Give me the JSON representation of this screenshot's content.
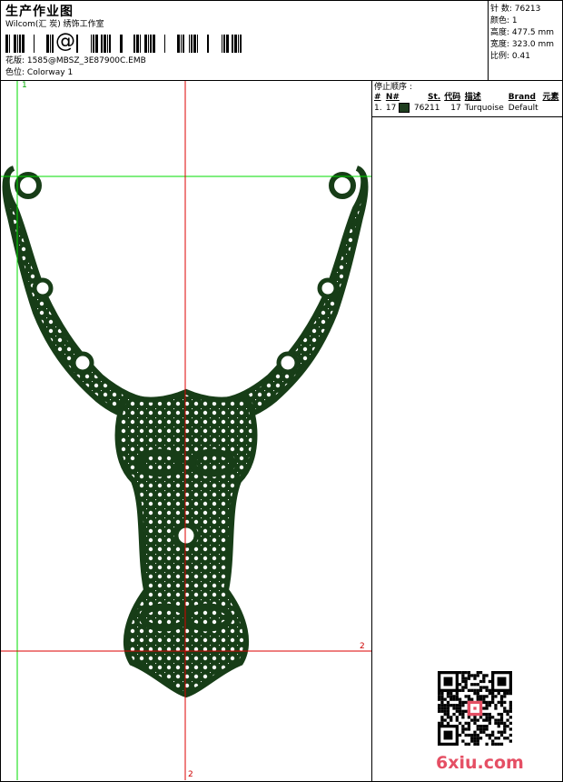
{
  "header": {
    "title": "生产作业图",
    "studio": "Wilcom(汇 炭) 绣饰工作室",
    "design_label": "花版:",
    "design_value": "1585@MBSZ_3E87900C.EMB",
    "colorway_label": "色位:",
    "colorway_value": "Colorway 1",
    "barcode_symbol": "@"
  },
  "stats": {
    "stitches": "针 数: 76213",
    "colors": "颜色: 1",
    "height": "高度: 477.5 mm",
    "width": "宽度: 323.0 mm",
    "scale": "比例: 0.41"
  },
  "sequence": {
    "title": "停止顺序 :",
    "columns": [
      "#",
      "N#",
      "St.",
      "代码",
      "描述",
      "Brand",
      "元素"
    ],
    "rows": [
      {
        "num": "1.",
        "needle": "17",
        "stitches": "76211",
        "code": "17",
        "desc": "Turquoise",
        "brand": "Default",
        "swatch": "#1f3d1f"
      }
    ]
  },
  "guides": {
    "top_label": "1",
    "right_label": "2",
    "bottom_label": "2"
  },
  "colors": {
    "thread": "#173d17",
    "guide_green": "#00dd00",
    "guide_red": "#dd0000",
    "brand": "#e54f64"
  },
  "watermark": {
    "text": "6xiu.com"
  }
}
